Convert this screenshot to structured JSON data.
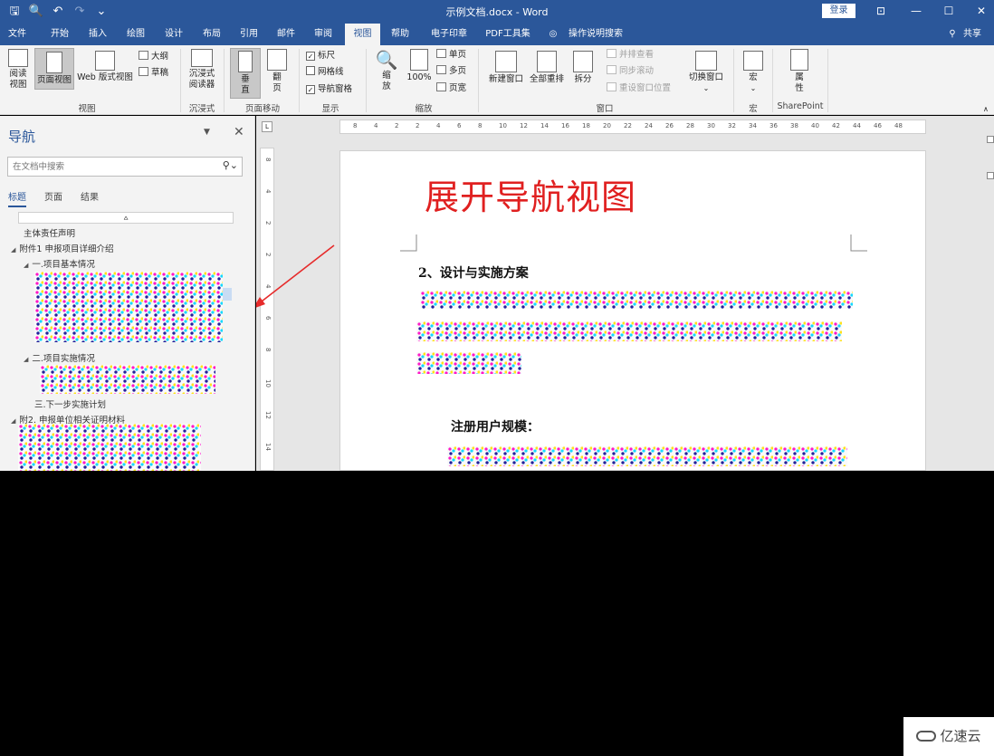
{
  "window": {
    "title": "示例文档.docx  -  Word",
    "login": "登录"
  },
  "tabs": [
    "文件",
    "开始",
    "插入",
    "绘图",
    "设计",
    "布局",
    "引用",
    "邮件",
    "审阅",
    "视图",
    "帮助",
    "电子印章",
    "PDF工具集",
    "操作说明搜索"
  ],
  "share": "共享",
  "ribbon": {
    "read_mode": [
      "阅读",
      "视图"
    ],
    "print_layout": "页面视图",
    "web_layout": "Web 版式视图",
    "outline": "大纲",
    "draft": "草稿",
    "group_views": "视图",
    "immersive_reader": [
      "沉浸式",
      "阅读器"
    ],
    "group_immersive": "沉浸式",
    "vertical": [
      "垂",
      "直"
    ],
    "side_to_side": [
      "翻",
      "页"
    ],
    "group_page_move": "页面移动",
    "ruler": "标尺",
    "gridlines": "网格线",
    "nav_pane": "导航窗格",
    "group_show": "显示",
    "zoom": [
      "缩",
      "放"
    ],
    "zoom100": "100%",
    "one_page": "单页",
    "multi_page": "多页",
    "page_width": "页宽",
    "group_zoom": "缩放",
    "new_window": "新建窗口",
    "arrange_all": "全部重排",
    "split": "拆分",
    "side_by_side": "并排查看",
    "sync_scroll": "同步滚动",
    "reset_pos": "重设窗口位置",
    "switch_window": "切换窗口",
    "group_window": "窗口",
    "macros": "宏",
    "group_macros": "宏",
    "properties": [
      "属",
      "性"
    ],
    "group_sharepoint": "SharePoint"
  },
  "nav": {
    "title": "导航",
    "search_placeholder": "在文档中搜索",
    "tabs": [
      "标题",
      "页面",
      "结果"
    ],
    "items": [
      "主体责任声明",
      "附件1  申报项目详细介绍",
      "一.项目基本情况",
      "二.项目实施情况",
      "三.下一步实施计划",
      "附2. 申报单位相关证明材料"
    ]
  },
  "ruler_h": [
    "8",
    "4",
    "2",
    "2",
    "4",
    "6",
    "8",
    "10",
    "12",
    "14",
    "16",
    "18",
    "20",
    "22",
    "24",
    "26",
    "28",
    "30",
    "32",
    "34",
    "36",
    "38",
    "40",
    "42",
    "44",
    "46",
    "48"
  ],
  "ruler_v": [
    "8",
    "4",
    "2",
    "2",
    "4",
    "6",
    "8",
    "10",
    "12",
    "14"
  ],
  "document": {
    "heading": "展开导航视图",
    "section": "2、设计与实施方案",
    "subheading": "注册用户规模："
  },
  "watermark": "亿速云",
  "colors": {
    "accent": "#2b579a",
    "heading": "#e02020",
    "arrow": "#e62b2b"
  }
}
